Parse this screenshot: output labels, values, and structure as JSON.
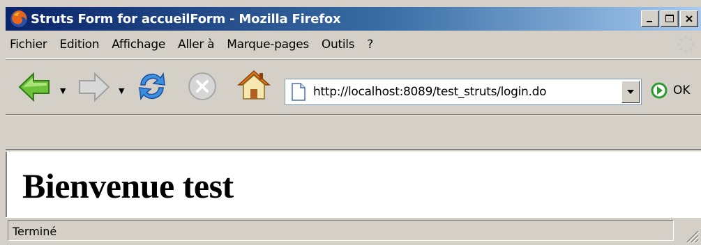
{
  "window": {
    "title": "Struts Form for accueilForm - Mozilla Firefox",
    "buttons": {
      "minimize": "minimize-icon",
      "maximize": "maximize-icon",
      "close": "close-icon"
    }
  },
  "menu": {
    "items": [
      {
        "label": "Fichier"
      },
      {
        "label": "Edition"
      },
      {
        "label": "Affichage"
      },
      {
        "label": "Aller à"
      },
      {
        "label": "Marque-pages"
      },
      {
        "label": "Outils"
      },
      {
        "label": "?"
      }
    ]
  },
  "navigation": {
    "icons": [
      "back-arrow-icon",
      "forward-arrow-icon",
      "reload-icon",
      "stop-icon",
      "home-icon"
    ],
    "url": "http://localhost:8089/test_struts/login.do",
    "go_label": "OK"
  },
  "page": {
    "heading": "Bienvenue test"
  },
  "status": {
    "text": "Terminé"
  },
  "colors": {
    "titlebar_start": "#0a246a",
    "titlebar_end": "#a6caf0",
    "chrome": "#d4d0c8",
    "content_bg": "#ffffff"
  }
}
